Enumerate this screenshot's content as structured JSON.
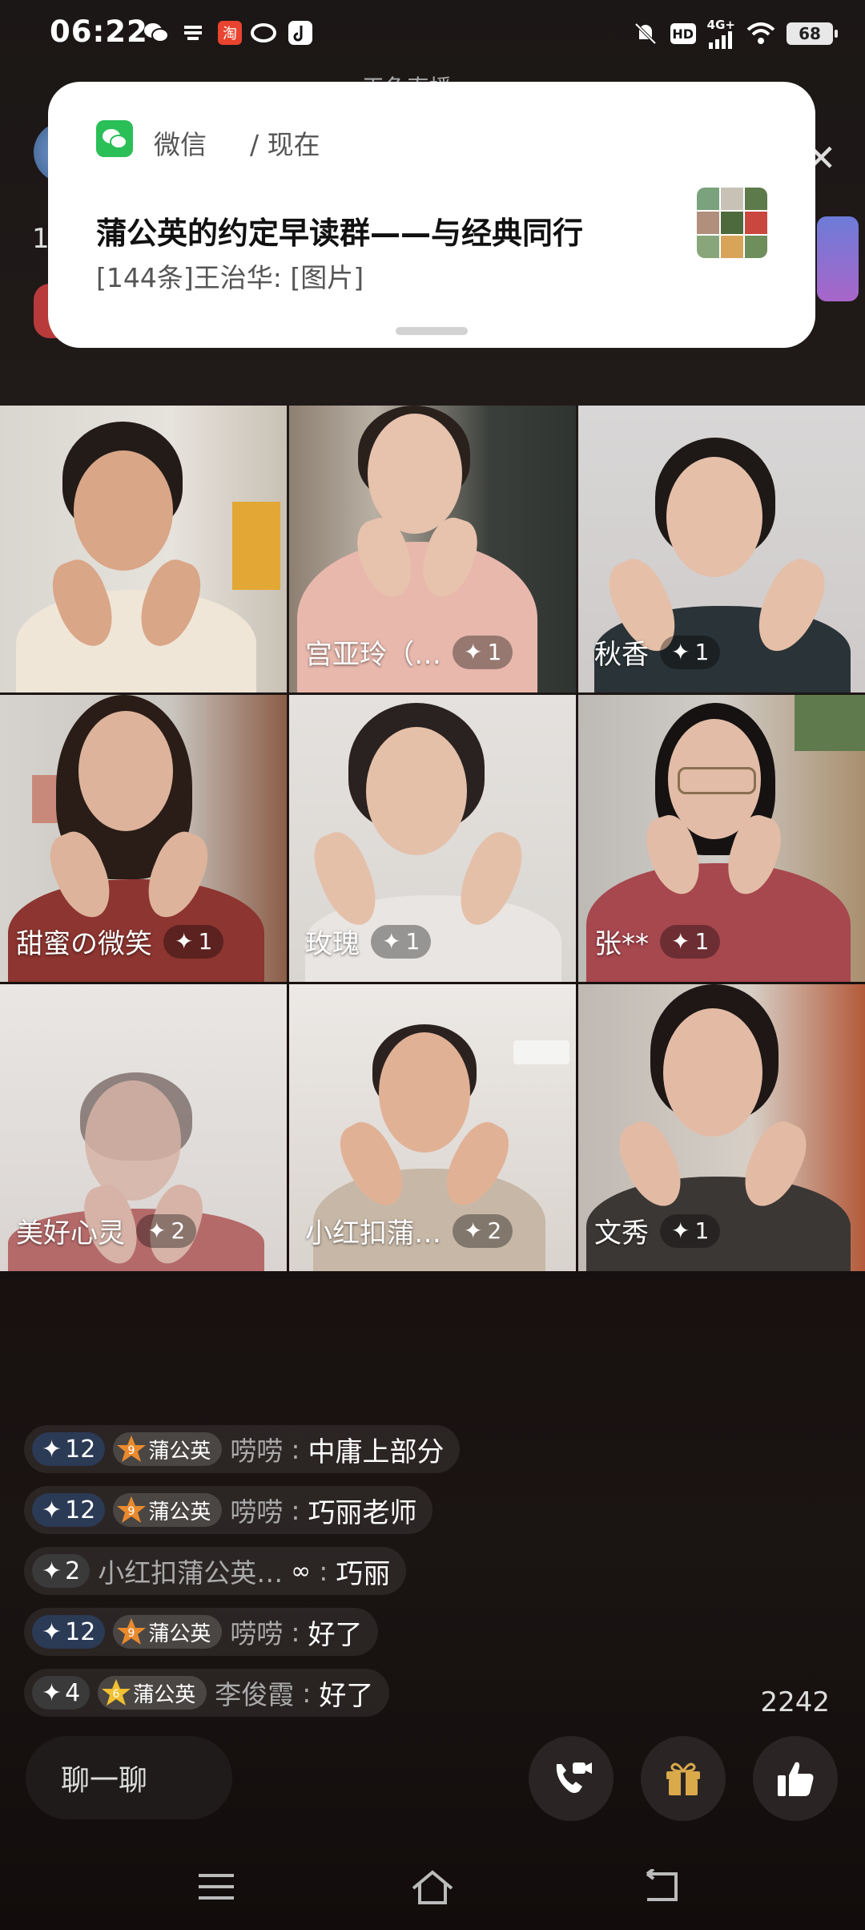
{
  "status_bar": {
    "time": "06:22",
    "battery": "68",
    "hd_label": "HD",
    "network_label": "4G+"
  },
  "room": {
    "title_partial": "天鱼直播",
    "side_digit": "1"
  },
  "notification": {
    "app_name": "微信",
    "time": "/  现在",
    "title": "蒲公英的约定早读群——与经典同行",
    "body": "[144条]王治华: [图片]"
  },
  "tiles": [
    {
      "name": "",
      "badge": ""
    },
    {
      "name": "宫亚玲（…",
      "badge": "1"
    },
    {
      "name": "秋香",
      "badge": "1"
    },
    {
      "name": "甜蜜の微笑",
      "badge": "1"
    },
    {
      "name": "玫瑰",
      "badge": "1"
    },
    {
      "name": "张**",
      "badge": "1"
    },
    {
      "name": "美好心灵",
      "badge": "2"
    },
    {
      "name": "小红扣蒲…",
      "badge": "2"
    },
    {
      "name": "文秀",
      "badge": "1"
    }
  ],
  "chat": [
    {
      "level": "12",
      "fan_level": "9",
      "fan_label": "蒲公英",
      "user": "唠唠",
      "msg": "中庸上部分"
    },
    {
      "level": "12",
      "fan_level": "9",
      "fan_label": "蒲公英",
      "user": "唠唠",
      "msg": "巧丽老师"
    },
    {
      "level": "2",
      "fan_level": "",
      "fan_label": "",
      "user": "小红扣蒲公英…",
      "msg": "巧丽"
    },
    {
      "level": "12",
      "fan_level": "9",
      "fan_label": "蒲公英",
      "user": "唠唠",
      "msg": "好了"
    },
    {
      "level": "4",
      "fan_level": "6",
      "fan_label": "蒲公英",
      "user": "李俊霞",
      "msg": "好了"
    }
  ],
  "like_count": "2242",
  "bottom": {
    "chat_input_label": "聊一聊"
  },
  "colors": {
    "wechat_green": "#2bbf58",
    "background": "#0f0c0b",
    "gift_gold": "#d9a94a"
  }
}
